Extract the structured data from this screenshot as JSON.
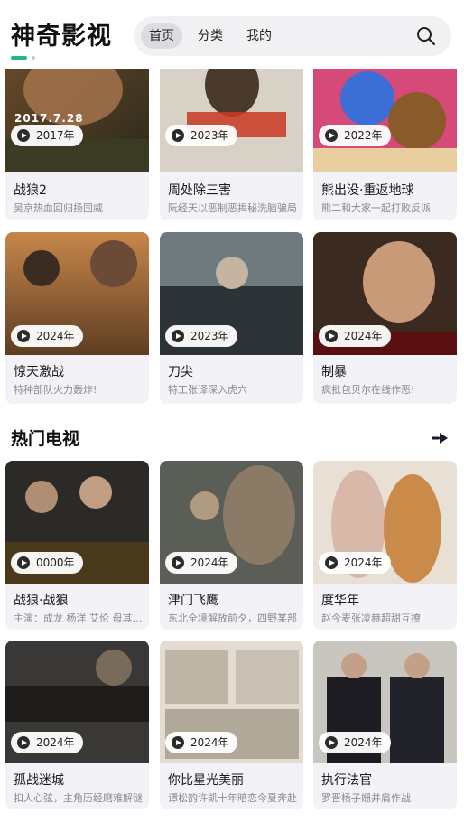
{
  "app": {
    "title": "神奇影视"
  },
  "nav": {
    "tabs": [
      {
        "label": "首页",
        "active": true
      },
      {
        "label": "分类",
        "active": false
      },
      {
        "label": "我的",
        "active": false
      }
    ],
    "search_icon": "search-icon"
  },
  "movies": [
    {
      "title": "战狼2",
      "desc": "吴京热血回归扬国威",
      "year": "2017年",
      "poster_caption": "2017.7.28"
    },
    {
      "title": "周处除三害",
      "desc": "阮经天以恶制恶揭秘洗脑骗局",
      "year": "2023年"
    },
    {
      "title": "熊出没·重返地球",
      "desc": "熊二和大家一起打败反派",
      "year": "2022年"
    },
    {
      "title": "惊天激战",
      "desc": "特种部队火力轰炸!",
      "year": "2024年"
    },
    {
      "title": "刀尖",
      "desc": "特工张译深入虎穴",
      "year": "2023年"
    },
    {
      "title": "制暴",
      "desc": "疯批包贝尔在线作恶!",
      "year": "2024年"
    }
  ],
  "tv_section": {
    "title": "热门电视",
    "more_icon": "arrow-right-icon"
  },
  "tv": [
    {
      "title": "战狼·战狼",
      "desc": "主演：成龙 杨洋 艾伦 母其弥雅",
      "year": "0000年"
    },
    {
      "title": "津门飞鹰",
      "desc": "东北全境解放前夕，四野某部",
      "year": "2024年"
    },
    {
      "title": "度华年",
      "desc": "赵今麦张凌赫超甜互撩",
      "year": "2024年"
    },
    {
      "title": "孤战迷城",
      "desc": "扣人心弦，主角历经磨难解谜",
      "year": "2024年"
    },
    {
      "title": "你比星光美丽",
      "desc": "谭松韵许凯十年暗恋今夏奔赴",
      "year": "2024年"
    },
    {
      "title": "执行法官",
      "desc": "罗晋杨子姗并肩作战",
      "year": "2024年"
    }
  ]
}
